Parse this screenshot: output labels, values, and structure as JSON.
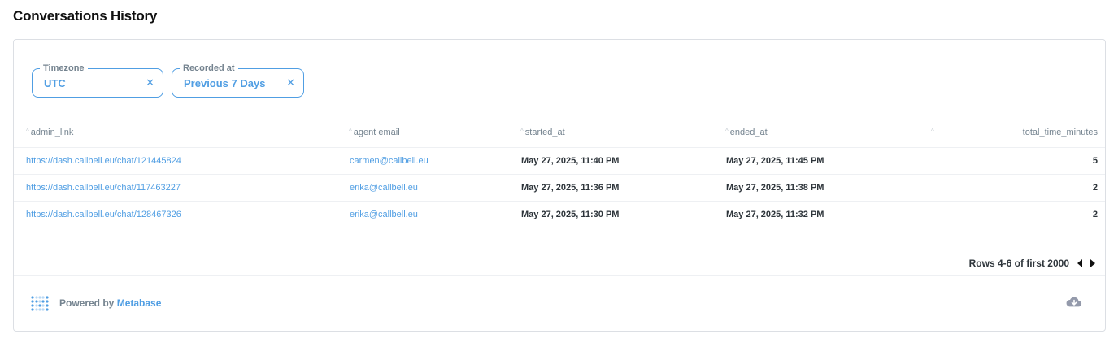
{
  "page_title": "Conversations History",
  "filters": [
    {
      "legend": "Timezone",
      "value": "UTC",
      "clear_icon": "close-icon"
    },
    {
      "legend": "Recorded at",
      "value": "Previous 7 Days",
      "clear_icon": "close-icon"
    }
  ],
  "table": {
    "columns": [
      "admin_link",
      "agent email",
      "started_at",
      "ended_at",
      "",
      "total_time_minutes"
    ],
    "rows": [
      {
        "admin_link": "https://dash.callbell.eu/chat/121445824",
        "agent_email": "carmen@callbell.eu",
        "started_at": "May 27, 2025, 11:40 PM",
        "ended_at": "May 27, 2025, 11:45 PM",
        "total_time_minutes": "5"
      },
      {
        "admin_link": "https://dash.callbell.eu/chat/117463227",
        "agent_email": "erika@callbell.eu",
        "started_at": "May 27, 2025, 11:36 PM",
        "ended_at": "May 27, 2025, 11:38 PM",
        "total_time_minutes": "2"
      },
      {
        "admin_link": "https://dash.callbell.eu/chat/128467326",
        "agent_email": "erika@callbell.eu",
        "started_at": "May 27, 2025, 11:30 PM",
        "ended_at": "May 27, 2025, 11:32 PM",
        "total_time_minutes": "2"
      }
    ]
  },
  "pagination": {
    "label": "Rows 4-6 of first 2000"
  },
  "footer": {
    "powered_prefix": "Powered by",
    "brand": "Metabase",
    "download_icon": "cloud-download-icon"
  },
  "colors": {
    "accent": "#509ee3",
    "text": "#2e353b",
    "muted": "#74838f",
    "border": "#dcdfe4"
  }
}
